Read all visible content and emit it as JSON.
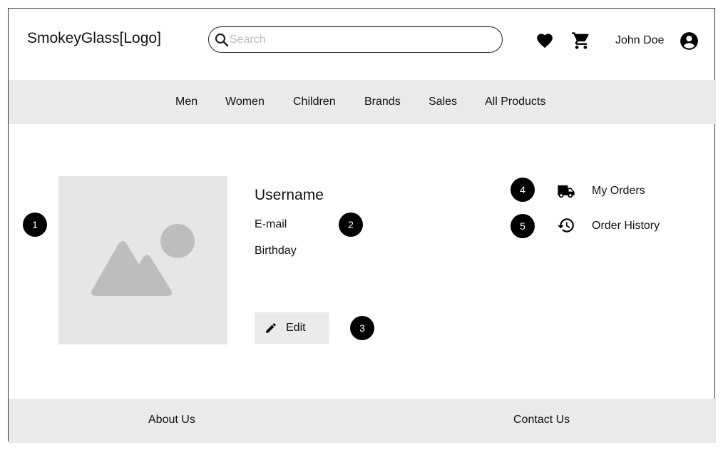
{
  "header": {
    "logo": "SmokeyGlass[Logo]",
    "search": {
      "placeholder": "Search",
      "value": ""
    },
    "wishlist_icon": "heart-icon",
    "cart_icon": "cart-icon",
    "user_name": "John Doe",
    "account_icon": "account-circle-icon"
  },
  "nav": {
    "items": [
      {
        "label": "Men"
      },
      {
        "label": "Women"
      },
      {
        "label": "Children"
      },
      {
        "label": "Brands"
      },
      {
        "label": "Sales"
      },
      {
        "label": "All Products"
      }
    ]
  },
  "profile": {
    "photo_icon": "image-placeholder-icon",
    "username": "Username",
    "email_label": "E-mail",
    "birthday_label": "Birthday",
    "edit_label": "Edit",
    "edit_icon": "pencil-icon"
  },
  "side_links": {
    "orders": {
      "label": "My Orders",
      "icon": "truck-icon"
    },
    "history": {
      "label": "Order History",
      "icon": "history-icon"
    }
  },
  "badges": [
    "1",
    "2",
    "3",
    "4",
    "5"
  ],
  "footer": {
    "about": "About Us",
    "contact": "Contact Us"
  },
  "colors": {
    "band_background": "#eaeaea",
    "photo_background": "#e6e6e6",
    "photo_shapes": "#bdbdbd",
    "badge": "#000000"
  }
}
